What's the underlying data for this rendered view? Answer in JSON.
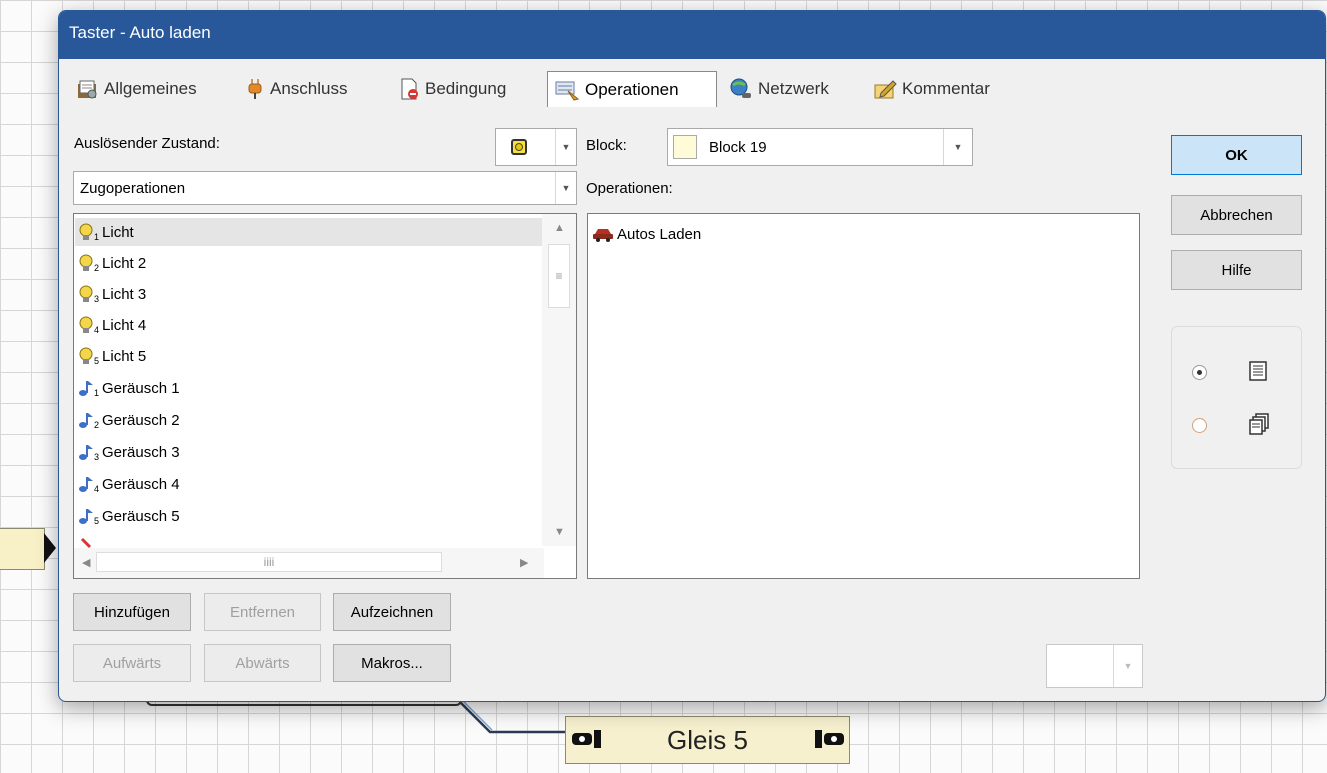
{
  "background": {
    "track_label": "Gleis 5"
  },
  "dialog": {
    "title": "Taster - Auto laden",
    "tabs": [
      {
        "label": "Allgemeines",
        "icon": "settings-icon"
      },
      {
        "label": "Anschluss",
        "icon": "plug-icon"
      },
      {
        "label": "Bedingung",
        "icon": "condition-icon"
      },
      {
        "label": "Operationen",
        "icon": "operations-icon",
        "active": true
      },
      {
        "label": "Netzwerk",
        "icon": "network-icon"
      },
      {
        "label": "Kommentar",
        "icon": "comment-icon"
      }
    ],
    "left": {
      "trigger_label": "Auslösender Zustand:",
      "category_value": "Zugoperationen",
      "items": [
        {
          "label": "Licht",
          "sub": "1",
          "icon": "bulb-icon"
        },
        {
          "label": "Licht 2",
          "sub": "2",
          "icon": "bulb-icon"
        },
        {
          "label": "Licht 3",
          "sub": "3",
          "icon": "bulb-icon"
        },
        {
          "label": "Licht 4",
          "sub": "4",
          "icon": "bulb-icon"
        },
        {
          "label": "Licht 5",
          "sub": "5",
          "icon": "bulb-icon"
        },
        {
          "label": "Geräusch 1",
          "sub": "1",
          "icon": "music-note-icon"
        },
        {
          "label": "Geräusch 2",
          "sub": "2",
          "icon": "music-note-icon"
        },
        {
          "label": "Geräusch 3",
          "sub": "3",
          "icon": "music-note-icon"
        },
        {
          "label": "Geräusch 4",
          "sub": "4",
          "icon": "music-note-icon"
        },
        {
          "label": "Geräusch 5",
          "sub": "5",
          "icon": "music-note-icon"
        }
      ],
      "hscroll_grip": "iiii"
    },
    "right": {
      "block_label": "Block:",
      "block_value": "Block 19",
      "operations_label": "Operationen:",
      "operations": [
        {
          "label": "Autos Laden",
          "icon": "car-icon"
        }
      ]
    },
    "buttons": {
      "add": "Hinzufügen",
      "remove": "Entfernen",
      "record": "Aufzeichnen",
      "up": "Aufwärts",
      "down": "Abwärts",
      "macros": "Makros...",
      "ok": "OK",
      "cancel": "Abbrechen",
      "help": "Hilfe"
    },
    "view_mode": {
      "options": [
        {
          "icon": "list-view-icon",
          "selected": true
        },
        {
          "icon": "tiled-view-icon",
          "selected": false
        }
      ]
    },
    "colors": {
      "titlebar": "#28589A",
      "ok_button": "#CCE4F7",
      "block_swatch": "#FFFBD6"
    }
  }
}
